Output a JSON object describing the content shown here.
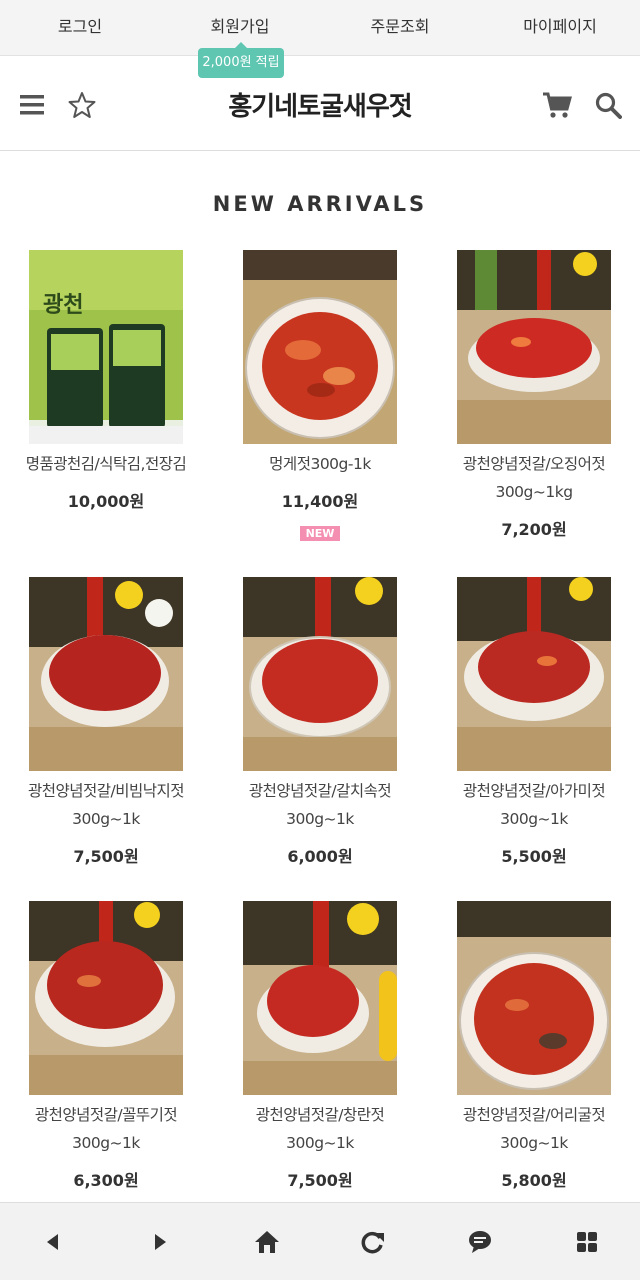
{
  "topbar": {
    "links": [
      "로그인",
      "회원가입",
      "주문조회",
      "마이페이지"
    ],
    "point_badge": "2,000원 적립"
  },
  "header": {
    "brand": "홍기네토굴새우젓",
    "icons": [
      "menu-icon",
      "star-icon",
      "cart-icon",
      "search-icon"
    ]
  },
  "section_title": "NEW ARRIVALS",
  "products": [
    {
      "name": "명품광천김/식탁김,전장김",
      "price": "10,000원",
      "badge": ""
    },
    {
      "name": "멍게젓300g-1k",
      "price": "11,400원",
      "badge": "NEW"
    },
    {
      "name": "광천양념젓갈/오징어젓 300g~1kg",
      "price": "7,200원",
      "badge": ""
    },
    {
      "name": "광천양념젓갈/비빔낙지젓 300g~1k",
      "price": "7,500원",
      "badge": ""
    },
    {
      "name": "광천양념젓갈/갈치속젓 300g~1k",
      "price": "6,000원",
      "badge": ""
    },
    {
      "name": "광천양념젓갈/아가미젓 300g~1k",
      "price": "5,500원",
      "badge": ""
    },
    {
      "name": "광천양념젓갈/꼴뚜기젓 300g~1k",
      "price": "6,300원",
      "badge": ""
    },
    {
      "name": "광천양념젓갈/창란젓 300g~1k",
      "price": "7,500원",
      "badge": ""
    },
    {
      "name": "광천양념젓갈/어리굴젓 300g~1k",
      "price": "5,800원",
      "badge": ""
    }
  ],
  "bottomnav": [
    "back-icon",
    "forward-icon",
    "home-icon",
    "refresh-icon",
    "chat-icon",
    "apps-icon"
  ],
  "colors": {
    "accent": "#5fc6b2",
    "new_badge": "#f48fb1"
  }
}
